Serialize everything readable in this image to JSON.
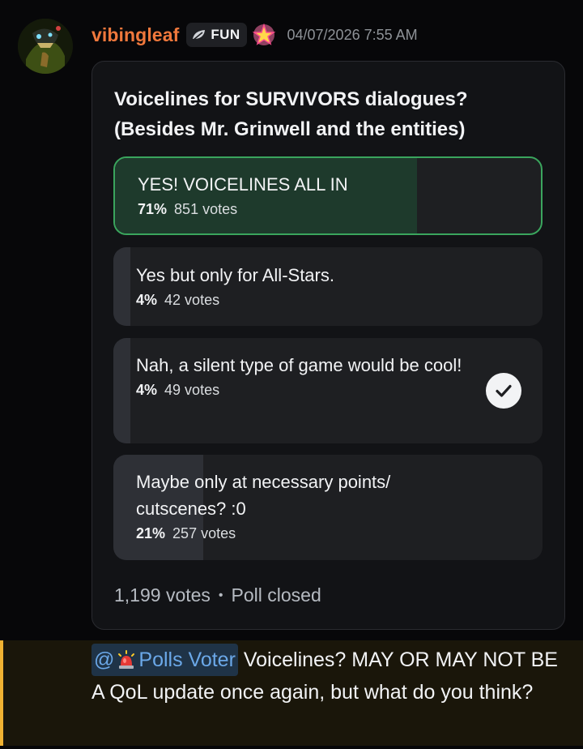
{
  "author": {
    "username": "vibingleaf",
    "tag_label": "FUN",
    "tag_icon": "leaf-icon",
    "badge_icon": "sparkle-star-icon",
    "timestamp": "04/07/2026 7:55 AM",
    "username_color": "#f0783c"
  },
  "poll": {
    "question_line1": "Voicelines for SURVIVORS dialogues?",
    "question_line2": "(Besides Mr. Grinwell and the entities)",
    "options": [
      {
        "label": "YES! VOICELINES ALL IN",
        "percent_label": "71%",
        "votes_label": "851 votes",
        "fill_fraction": 0.71,
        "winner": true,
        "selected": false
      },
      {
        "label": "Yes but only for All-Stars.",
        "percent_label": "4%",
        "votes_label": "42 votes",
        "fill_fraction": 0.04,
        "winner": false,
        "selected": false
      },
      {
        "label": "Nah, a silent type of game would be cool!",
        "percent_label": "4%",
        "votes_label": "49 votes",
        "fill_fraction": 0.04,
        "winner": false,
        "selected": true
      },
      {
        "label": "Maybe only at necessary points/ cutscenes? :0",
        "percent_label": "21%",
        "votes_label": "257 votes",
        "fill_fraction": 0.21,
        "winner": false,
        "selected": false
      }
    ],
    "total_votes": "1,199 votes",
    "separator": "•",
    "status": "Poll closed",
    "winner_color": "#3aa55d"
  },
  "message": {
    "mention_at": "@",
    "mention_icon": "siren-icon",
    "mention_role": "Polls Voter",
    "text": " Voicelines? MAY OR MAY NOT BE A QoL update once again, but what do you think?",
    "highlight_color": "#f0b232"
  }
}
